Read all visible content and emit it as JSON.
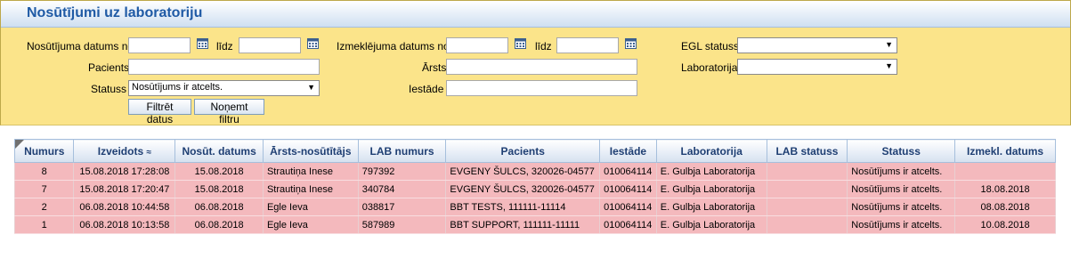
{
  "title": "Nosūtījumi uz laboratoriju",
  "filters": {
    "sent_date_from_label": "Nosūtījuma datums no",
    "sent_date_to_label": "līdz",
    "exam_date_from_label": "Izmeklējuma datums no",
    "exam_date_to_label": "līdz",
    "egl_status_label": "EGL statuss",
    "patient_label": "Pacients",
    "doctor_label": "Ārsts",
    "laboratory_label": "Laboratorija",
    "status_label": "Statuss",
    "institution_label": "Iestāde",
    "status_value": "Nosūtījums ir atcelts.",
    "egl_status_value": "",
    "laboratory_value": "",
    "sent_date_from_value": "",
    "sent_date_to_value": "",
    "exam_date_from_value": "",
    "exam_date_to_value": "",
    "patient_value": "",
    "doctor_value": "",
    "institution_value": "",
    "filter_button": "Filtrēt datus",
    "clear_button": "Noņemt filtru"
  },
  "table": {
    "columns": [
      "Numurs",
      "Izveidots",
      "Nosūt. datums",
      "Ārsts-nosūtītājs",
      "LAB numurs",
      "Pacients",
      "Iestāde",
      "Laboratorija",
      "LAB statuss",
      "Statuss",
      "Izmekl. datums"
    ],
    "sort_indicator": "≈",
    "rows": [
      {
        "numurs": "8",
        "izveidots": "15.08.2018 17:28:08",
        "nosut": "15.08.2018",
        "arsts": "Strautiņa Inese",
        "lab_nr": "797392",
        "pacients": "EVGENY ŠULCS, 320026-04577",
        "iestade": "010064114",
        "lab": "E. Gulbja Laboratorija",
        "lab_status": "",
        "statuss": "Nosūtījums ir atcelts.",
        "izmekl": ""
      },
      {
        "numurs": "7",
        "izveidots": "15.08.2018 17:20:47",
        "nosut": "15.08.2018",
        "arsts": "Strautiņa Inese",
        "lab_nr": "340784",
        "pacients": "EVGENY ŠULCS, 320026-04577",
        "iestade": "010064114",
        "lab": "E. Gulbja Laboratorija",
        "lab_status": "",
        "statuss": "Nosūtījums ir atcelts.",
        "izmekl": "18.08.2018"
      },
      {
        "numurs": "2",
        "izveidots": "06.08.2018 10:44:58",
        "nosut": "06.08.2018",
        "arsts": "Egle Ieva",
        "lab_nr": "038817",
        "pacients": "BBT TESTS, 111111-11114",
        "iestade": "010064114",
        "lab": "E. Gulbja Laboratorija",
        "lab_status": "",
        "statuss": "Nosūtījums ir atcelts.",
        "izmekl": "08.08.2018"
      },
      {
        "numurs": "1",
        "izveidots": "06.08.2018 10:13:58",
        "nosut": "06.08.2018",
        "arsts": "Egle Ieva",
        "lab_nr": "587989",
        "pacients": "BBT SUPPORT, 111111-11111",
        "iestade": "010064114",
        "lab": "E. Gulbja Laboratorija",
        "lab_status": "",
        "statuss": "Nosūtījums ir atcelts.",
        "izmekl": "10.08.2018"
      }
    ]
  }
}
